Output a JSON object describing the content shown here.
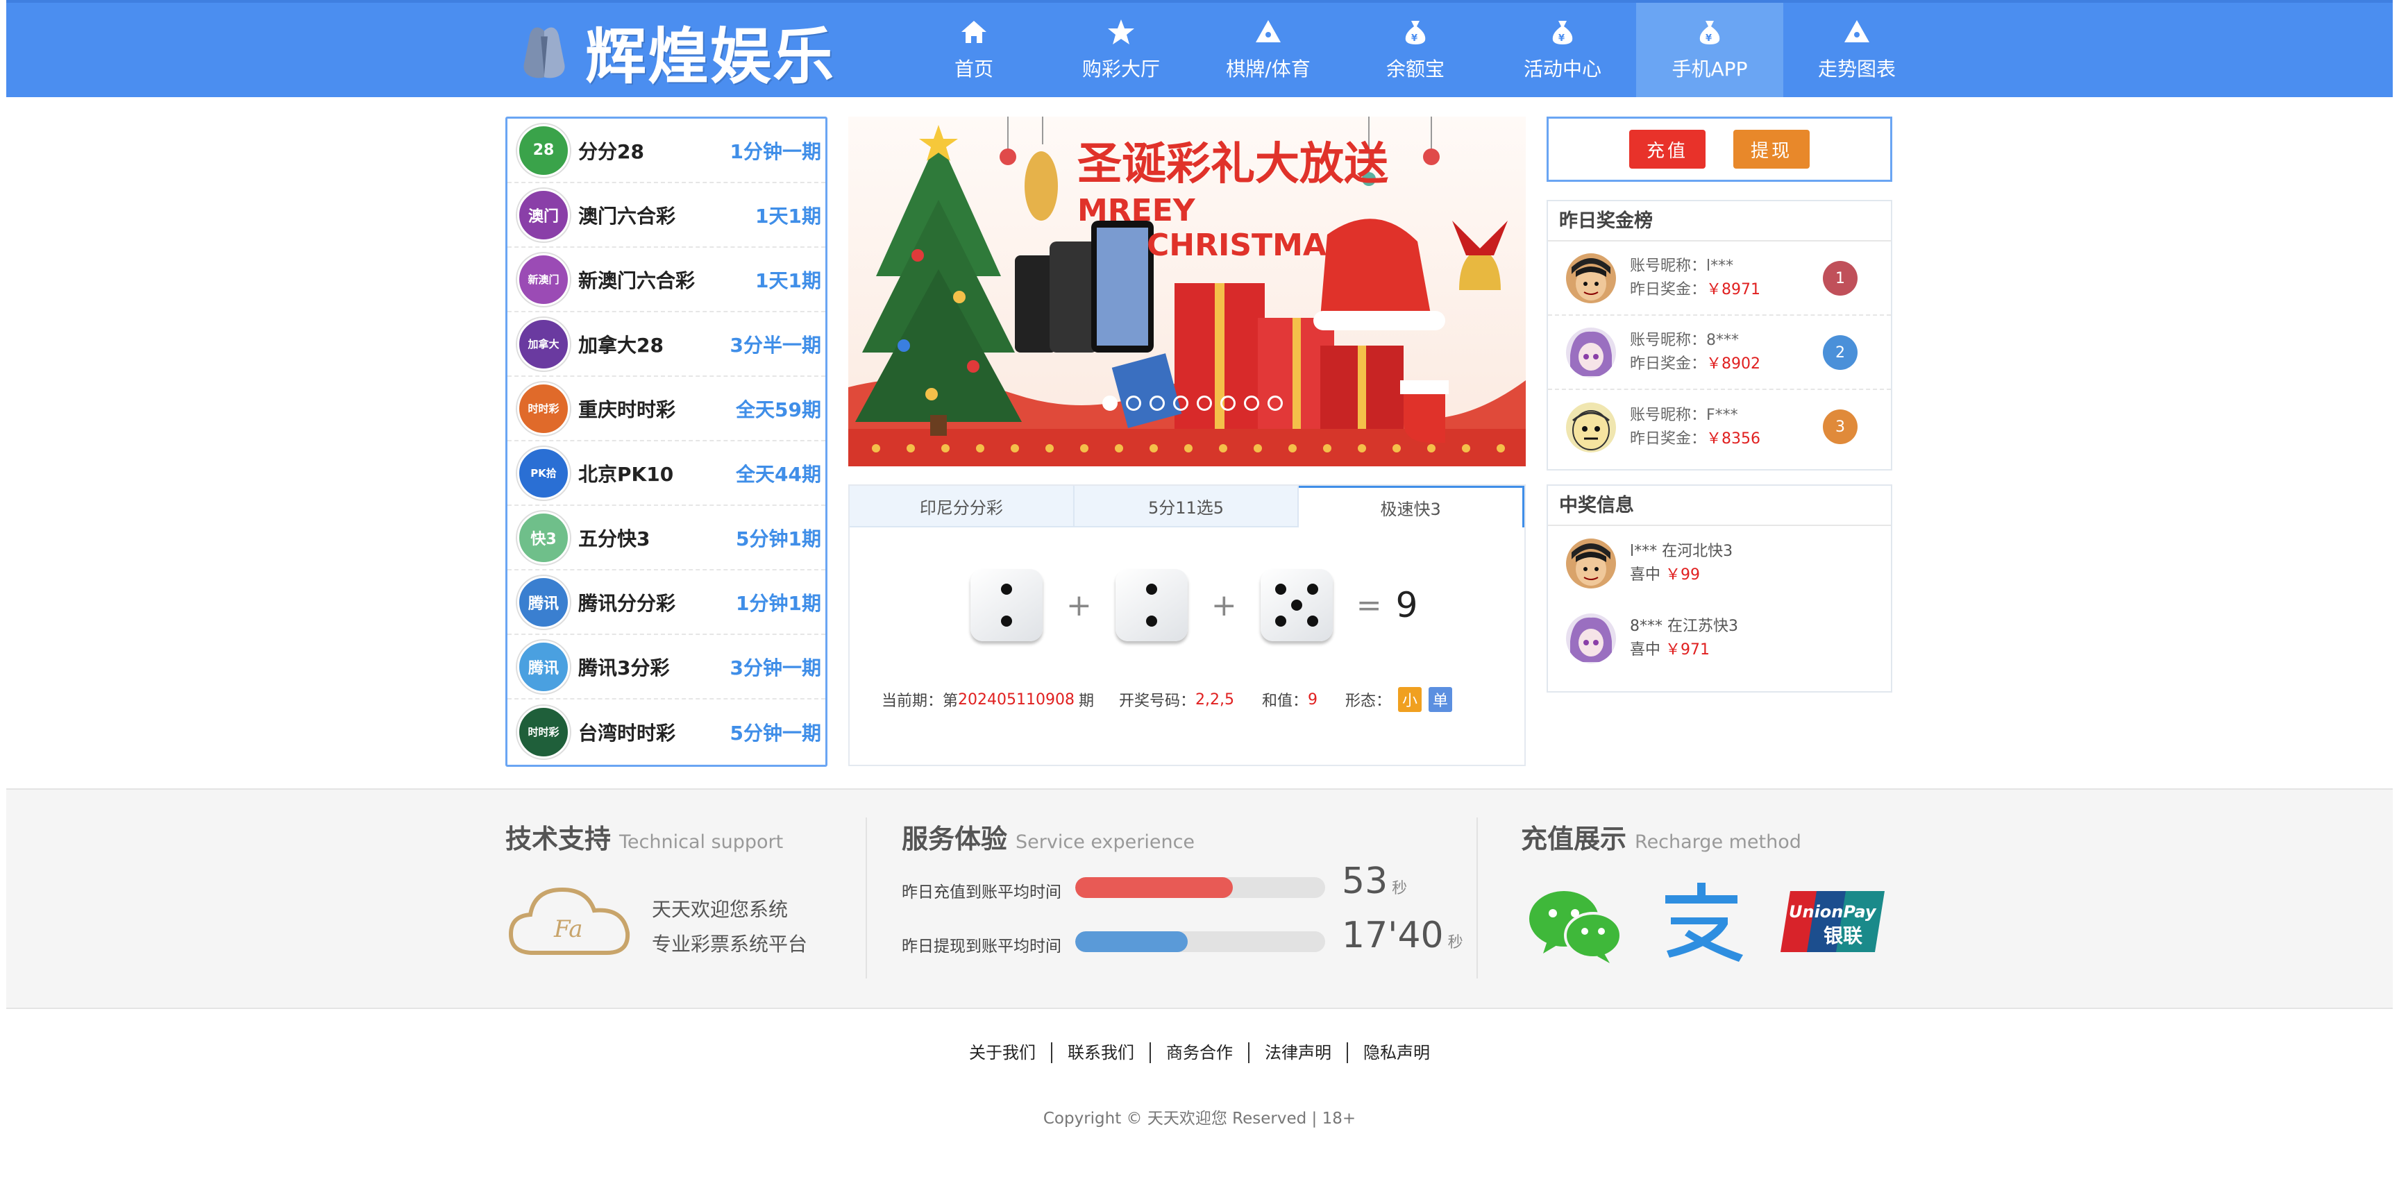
{
  "brand": {
    "name": "辉煌娱乐"
  },
  "nav": [
    {
      "label": "首页",
      "icon": "home-icon"
    },
    {
      "label": "购彩大厅",
      "icon": "star-icon"
    },
    {
      "label": "棋牌/体育",
      "icon": "triangle-icon"
    },
    {
      "label": "余额宝",
      "icon": "money-bag-icon"
    },
    {
      "label": "活动中心",
      "icon": "money-bag-icon"
    },
    {
      "label": "手机APP",
      "icon": "money-bag-icon"
    },
    {
      "label": "走势图表",
      "icon": "triangle-icon"
    }
  ],
  "nav_active": "手机APP",
  "lotteries": [
    {
      "name": "分分28",
      "period": "1分钟一期",
      "badge": "28",
      "color": "#3aa34a"
    },
    {
      "name": "澳门六合彩",
      "period": "1天1期",
      "badge": "澳门",
      "color": "#8a3fa8"
    },
    {
      "name": "新澳门六合彩",
      "period": "1天1期",
      "badge": "新澳门",
      "color": "#9b4bb5"
    },
    {
      "name": "加拿大28",
      "period": "3分半一期",
      "badge": "加拿大",
      "color": "#6a3aa0"
    },
    {
      "name": "重庆时时彩",
      "period": "全天59期",
      "badge": "时时彩",
      "color": "#e06a2a"
    },
    {
      "name": "北京PK10",
      "period": "全天44期",
      "badge": "PK拾",
      "color": "#2a6fd4"
    },
    {
      "name": "五分快3",
      "period": "5分钟1期",
      "badge": "快3",
      "color": "#6fbf8a"
    },
    {
      "name": "腾讯分分彩",
      "period": "1分钟1期",
      "badge": "腾讯",
      "color": "#3a7fd0"
    },
    {
      "name": "腾讯3分彩",
      "period": "3分钟一期",
      "badge": "腾讯",
      "color": "#4aa0e0"
    },
    {
      "name": "台湾时时彩",
      "period": "5分钟一期",
      "badge": "时时彩",
      "color": "#1f5f3a"
    }
  ],
  "banner": {
    "headline": "圣诞彩礼大放送",
    "line1": "MREEY",
    "line2": "CHRISTMAS",
    "dot_count": 8,
    "active_dot": 0
  },
  "result": {
    "tabs": [
      "印尼分分彩",
      "5分11选5",
      "极速快3"
    ],
    "active_tab": 2,
    "dice": [
      2,
      2,
      5
    ],
    "sum": "9",
    "plus": "+",
    "equals": "=",
    "period_label": "当前期：第",
    "period": "202405110908",
    "period_suffix": "期",
    "numbers_label": "开奖号码：",
    "numbers": "2,2,5",
    "sum_label": "和值：",
    "sum_value": "9",
    "shape_label": "形态：",
    "shape_tags": [
      {
        "text": "小",
        "color": "#f0a020"
      },
      {
        "text": "单",
        "color": "#5b8fe0"
      }
    ]
  },
  "fund": {
    "deposit": "充值",
    "withdraw": "提现",
    "deposit_color": "#e8322a",
    "withdraw_color": "#e8882a"
  },
  "rank": {
    "title": "昨日奖金榜",
    "rows": [
      {
        "nick_label": "账号昵称：",
        "nick": "l***",
        "bonus_label": "昨日奖金：",
        "bonus": "￥8971",
        "rank": "1",
        "badge_color": "#c0505a",
        "avatar": "luffy"
      },
      {
        "nick_label": "账号昵称：",
        "nick": "8***",
        "bonus_label": "昨日奖金：",
        "bonus": "￥8902",
        "rank": "2",
        "badge_color": "#4a90d9",
        "avatar": "purple"
      },
      {
        "nick_label": "账号昵称：",
        "nick": "F***",
        "bonus_label": "昨日奖金：",
        "bonus": "￥8356",
        "rank": "3",
        "badge_color": "#e08a3a",
        "avatar": "cartoon"
      }
    ]
  },
  "wins": {
    "title": "中奖信息",
    "rows": [
      {
        "who": "l*** 在河北快3",
        "won_label": "喜中",
        "amount": "￥99",
        "avatar": "luffy"
      },
      {
        "who": "8*** 在江苏快3",
        "won_label": "喜中",
        "amount": "￥971",
        "avatar": "purple"
      }
    ]
  },
  "support": {
    "title": "技术支持",
    "subtitle": "Technical support",
    "line1": "天天欢迎您系统",
    "line2": "专业彩票系统平台"
  },
  "service": {
    "title": "服务体验",
    "subtitle": "Service experience",
    "items": [
      {
        "label": "昨日充值到账平均时间",
        "value": "53",
        "unit": "秒",
        "fill": 0.63,
        "color": "#e85a55"
      },
      {
        "label": "昨日提现到账平均时间",
        "value": "17'40",
        "unit": "秒",
        "fill": 0.45,
        "color": "#5a9ad8"
      }
    ]
  },
  "recharge": {
    "title": "充值展示",
    "subtitle": "Recharge method",
    "methods": [
      "WeChat",
      "Alipay",
      "UnionPay"
    ],
    "unionpay_text": "UnionPay",
    "unionpay_cn": "银联"
  },
  "footer": {
    "links": [
      "关于我们",
      "联系我们",
      "商务合作",
      "法律声明",
      "隐私声明"
    ],
    "copyright": "Copyright © 天天欢迎您 Reserved | 18+"
  }
}
